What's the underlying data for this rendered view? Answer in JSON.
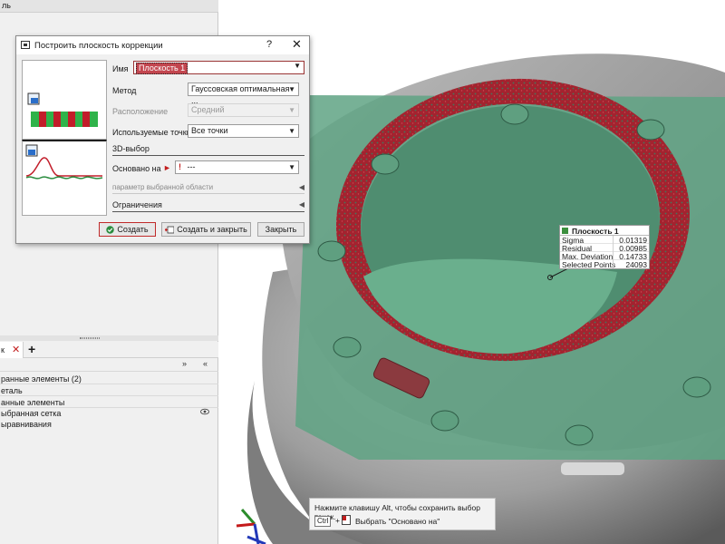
{
  "left_panel": {
    "top_label": "ль",
    "tabs": {
      "active_label": "к",
      "close": "✕",
      "add": "+"
    },
    "toolbar": {
      "collapse": "»",
      "expand": "«"
    },
    "tree": [
      {
        "text": "ранные элементы (2)"
      },
      {
        "text": "еталь"
      },
      {
        "text": "анные элементы"
      },
      {
        "text": "ыбранная сетка"
      },
      {
        "text": "ыравнивания"
      }
    ]
  },
  "dialog": {
    "title": "Построить плоскость коррекции",
    "help": "?",
    "close": "✕",
    "fields": {
      "name_label": "Имя",
      "name_value": "Плоскость 1",
      "method_label": "Метод",
      "method_value": "Гауссовская оптимальная ...",
      "location_label": "Расположение",
      "location_value": "Средний",
      "points_label": "Используемые точки",
      "points_value": "Все точки",
      "select3d_label": "3D-выбор",
      "based_on_label": "Основано на",
      "based_on_value": "---",
      "region_param_label": "параметр выбранной области",
      "limits_label": "Ограничения"
    },
    "buttons": {
      "create": "Создать",
      "create_close": "Создать и закрыть",
      "close": "Закрыть"
    }
  },
  "annotation": {
    "title": "Плоскость 1",
    "rows": [
      {
        "key": "Sigma",
        "value": "0.01319"
      },
      {
        "key": "Residual",
        "value": "0.00985"
      },
      {
        "key": "Max. Deviation",
        "value": "0.14733"
      },
      {
        "key": "Selected Points",
        "value": "24093"
      }
    ]
  },
  "hint": {
    "line1": "Нажмите клавишу Alt, чтобы сохранить выбор точек.",
    "key": "Ctrl",
    "plus": "+",
    "line2": "Выбрать \"Основано на\""
  },
  "colors": {
    "plane_green": "#5fa384",
    "deviation_red": "#a3232f",
    "part_gray": "#9a9a9a",
    "accent": "#c02a2a"
  }
}
